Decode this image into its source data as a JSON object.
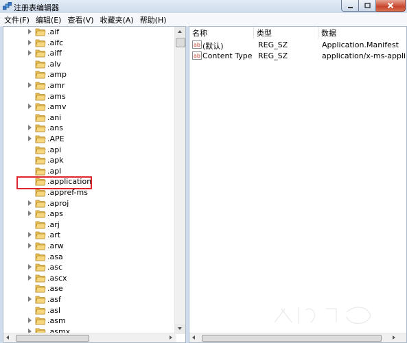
{
  "window": {
    "title": "注册表编辑器"
  },
  "menu": [
    {
      "label": "文件(F)"
    },
    {
      "label": "编辑(E)"
    },
    {
      "label": "查看(V)"
    },
    {
      "label": "收藏夹(A)"
    },
    {
      "label": "帮助(H)"
    }
  ],
  "tree": {
    "items": [
      {
        "label": ".aif",
        "expandable": true
      },
      {
        "label": ".aifc",
        "expandable": true
      },
      {
        "label": ".aiff",
        "expandable": true
      },
      {
        "label": ".alv",
        "expandable": false
      },
      {
        "label": ".amp",
        "expandable": false
      },
      {
        "label": ".amr",
        "expandable": true
      },
      {
        "label": ".ams",
        "expandable": false
      },
      {
        "label": ".amv",
        "expandable": true
      },
      {
        "label": ".ani",
        "expandable": false
      },
      {
        "label": ".ans",
        "expandable": true
      },
      {
        "label": ".APE",
        "expandable": true
      },
      {
        "label": ".api",
        "expandable": false
      },
      {
        "label": ".apk",
        "expandable": false
      },
      {
        "label": ".apl",
        "expandable": false
      },
      {
        "label": ".application",
        "expandable": false,
        "selected": true
      },
      {
        "label": ".appref-ms",
        "expandable": false
      },
      {
        "label": ".aproj",
        "expandable": true
      },
      {
        "label": ".aps",
        "expandable": true
      },
      {
        "label": ".arj",
        "expandable": false
      },
      {
        "label": ".art",
        "expandable": true
      },
      {
        "label": ".arw",
        "expandable": true
      },
      {
        "label": ".asa",
        "expandable": false
      },
      {
        "label": ".asc",
        "expandable": true
      },
      {
        "label": ".ascx",
        "expandable": true
      },
      {
        "label": ".ase",
        "expandable": false
      },
      {
        "label": ".asf",
        "expandable": true
      },
      {
        "label": ".asl",
        "expandable": false
      },
      {
        "label": ".asm",
        "expandable": true
      },
      {
        "label": ".asmx",
        "expandable": true
      }
    ]
  },
  "values": {
    "columns": [
      {
        "label": "名称"
      },
      {
        "label": "类型"
      },
      {
        "label": "数据"
      }
    ],
    "rows": [
      {
        "name": "(默认)",
        "type": "REG_SZ",
        "data": "Application.Manifest",
        "icon": "string-value-icon"
      },
      {
        "name": "Content Type",
        "type": "REG_SZ",
        "data": "application/x-ms-applicatic",
        "icon": "string-value-icon"
      }
    ]
  },
  "colors": {
    "highlight_border": "#e0262b",
    "folder": "#e9c15a",
    "title_bar": "#cfdcec"
  }
}
